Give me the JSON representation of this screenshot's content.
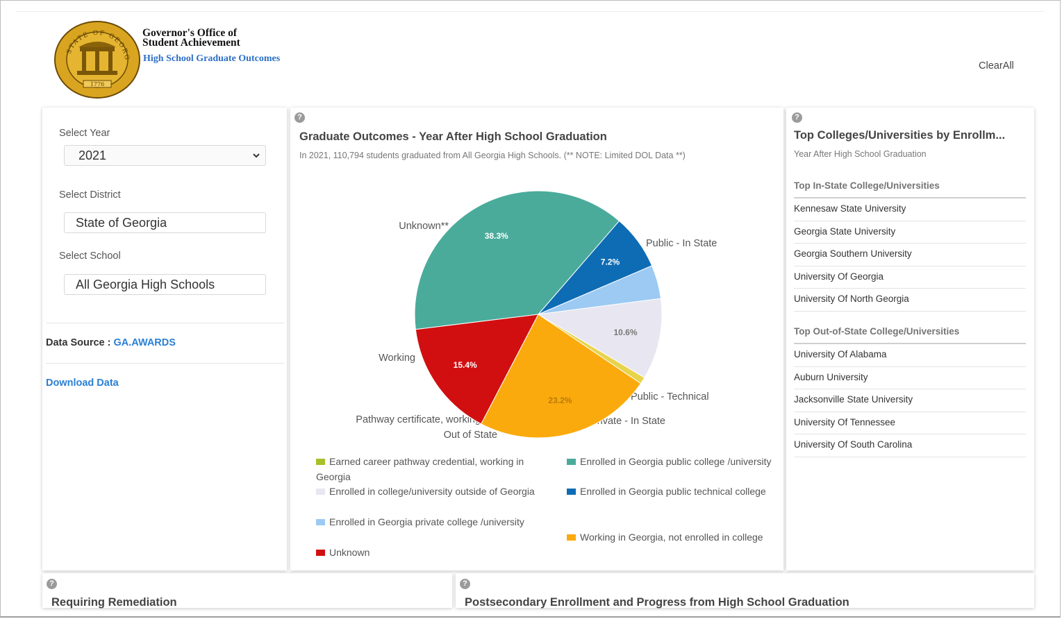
{
  "header": {
    "org_name_line1": "Governor's Office of",
    "org_name_line2": "Student Achievement",
    "app_subtitle": "High School Graduate Outcomes",
    "clear_all": "ClearAll",
    "seal_text": "STATE OF GEORGIA",
    "seal_year": "1776"
  },
  "filters": {
    "year_label": "Select Year",
    "year_value": "2021",
    "district_label": "Select District",
    "district_value": "State of Georgia",
    "school_label": "Select School",
    "school_value": "All Georgia High Schools",
    "data_source_label": "Data Source : ",
    "data_source_link": "GA.AWARDS",
    "download_label": "Download Data"
  },
  "main_chart": {
    "help": "?",
    "title": "Graduate Outcomes - Year After High School Graduation",
    "subtitle": "In 2021, 110,794 students graduated from All Georgia High Schools. (** NOTE: Limited DOL Data **)",
    "chart_data": {
      "type": "pie",
      "slices": [
        {
          "key": "public_in_state",
          "callout": "Public - In State",
          "value": 38.3,
          "data_label": "38.3%",
          "color": "#4aab9b",
          "label_color": "#ffffff"
        },
        {
          "key": "public_technical",
          "callout": "Public - Technical",
          "value": 7.2,
          "data_label": "7.2%",
          "color": "#0e6cb4",
          "label_color": "#ffffff"
        },
        {
          "key": "private_in_state",
          "callout": "Private - In State",
          "value": 4.4,
          "data_label": "",
          "color": "#9ccaf3",
          "label_color": "#ffffff"
        },
        {
          "key": "out_of_state",
          "callout": "Out of State",
          "value": 10.6,
          "data_label": "10.6%",
          "color": "#e8e6f0",
          "label_color": "#777777"
        },
        {
          "key": "pathway",
          "callout": "Pathway certificate, working",
          "value": 0.9,
          "data_label": "",
          "color": "#e8d44a",
          "label_color": "#ffffff"
        },
        {
          "key": "working",
          "callout": "Working",
          "value": 23.2,
          "data_label": "23.2%",
          "color": "#fbaa0e",
          "label_color": "#b97a08"
        },
        {
          "key": "unknown",
          "callout": "Unknown**",
          "value": 15.4,
          "data_label": "15.4%",
          "color": "#d10f10",
          "label_color": "#ffffff"
        }
      ],
      "legend": [
        {
          "text": "Earned career pathway credential, working in Georgia",
          "color": "#a8bf2a"
        },
        {
          "text": "Enrolled in Georgia public college /university",
          "color": "#4aab9b"
        },
        {
          "text": "Enrolled in college/university outside of Georgia",
          "color": "#e8e6f0"
        },
        {
          "text": "Enrolled in Georgia public technical college",
          "color": "#0e6cb4"
        },
        {
          "text": "Enrolled in Georgia private college /university",
          "color": "#9ccaf3"
        },
        {
          "text": "Working in Georgia, not enrolled in college",
          "color": "#fbaa0e"
        },
        {
          "text": "Unknown",
          "color": "#d10f10"
        }
      ]
    }
  },
  "top_colleges": {
    "help": "?",
    "title": "Top Colleges/Universities by Enrollm...",
    "subtitle": "Year After High School Graduation",
    "in_state_heading": "Top In-State College/Universities",
    "in_state": [
      "Kennesaw State University",
      "Georgia State University",
      "Georgia Southern University",
      "University Of Georgia",
      "University Of North Georgia"
    ],
    "out_state_heading": "Top Out-of-State College/Universities",
    "out_state": [
      "University Of Alabama",
      "Auburn University",
      "Jacksonville State University",
      "University Of Tennessee",
      "University Of South Carolina"
    ]
  },
  "bottom": {
    "remediation_title": "Requiring Remediation",
    "postsecondary_title": "Postsecondary Enrollment and Progress from High School Graduation",
    "help": "?"
  }
}
